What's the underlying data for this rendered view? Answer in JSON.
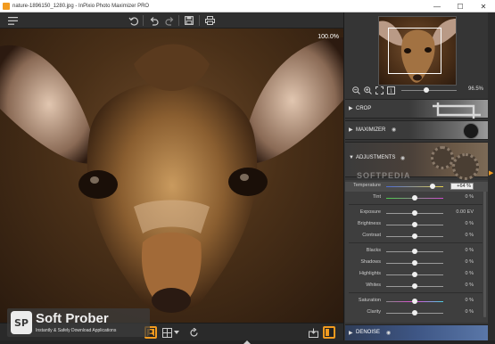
{
  "window": {
    "title": "nature-1896150_1280.jpg - InPixio Photo Maximizer PRO",
    "controls": {
      "minimize": "—",
      "maximize": "☐",
      "close": "✕"
    }
  },
  "toolbar": {
    "icons": [
      "menu-icon",
      "undo-history-icon",
      "undo-icon",
      "redo-icon",
      "save-icon",
      "print-icon"
    ]
  },
  "canvas": {
    "zoom_label": "100.0%"
  },
  "navigator": {
    "zoom_value": "96.5%",
    "zoom_level": 0.45
  },
  "sections": {
    "crop": "CROP",
    "maximizer": "MAXIMIZER",
    "adjustments": "ADJUSTMENTS",
    "denoise": "DENOISE"
  },
  "adjustments": [
    {
      "label": "Temperature",
      "value": "+64 %",
      "level": 0.82,
      "highlighted": true
    },
    {
      "label": "Tint",
      "value": "0 %",
      "level": 0.5
    },
    {
      "label": "Exposure",
      "value": "0.00 EV",
      "level": 0.5
    },
    {
      "label": "Brightness",
      "value": "0 %",
      "level": 0.5
    },
    {
      "label": "Contrast",
      "value": "0 %",
      "level": 0.5
    },
    {
      "label": "Blacks",
      "value": "0 %",
      "level": 0.5
    },
    {
      "label": "Shadows",
      "value": "0 %",
      "level": 0.5
    },
    {
      "label": "Highlights",
      "value": "0 %",
      "level": 0.5
    },
    {
      "label": "Whites",
      "value": "0 %",
      "level": 0.5
    },
    {
      "label": "Saturation",
      "value": "0 %",
      "level": 0.5
    },
    {
      "label": "Clarity",
      "value": "0 %",
      "level": 0.5
    }
  ],
  "watermark": {
    "logo": "SP",
    "title": "Soft Prober",
    "subtitle": "Instantly & Safely Download Applications",
    "overlay": "SOFTPEDIA"
  },
  "colors": {
    "accent": "#f29b1f",
    "panel": "#353535",
    "toolbar": "#2f2f2f"
  }
}
